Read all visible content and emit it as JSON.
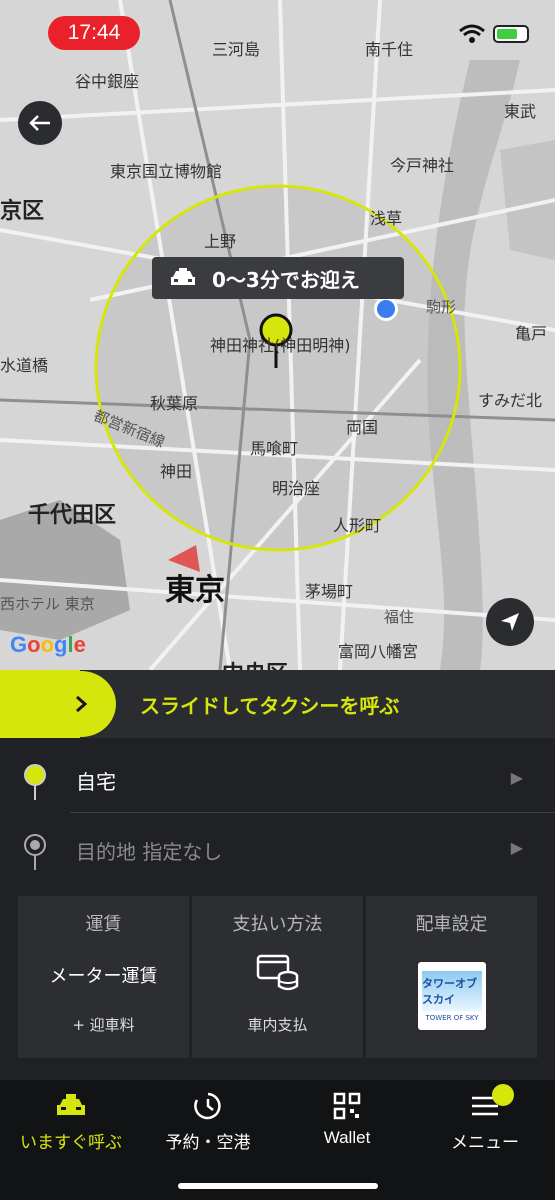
{
  "status_bar": {
    "time": "17:44"
  },
  "map": {
    "eta_text": "0～3分でお迎え",
    "labels": {
      "yanaka": "谷中銀座",
      "mikawashima": "三河島",
      "minamisenju": "南千住",
      "tokyo_museum": "東京国立博物館",
      "imado": "今戸神社",
      "bunkyo": "京区",
      "ueno": "上野",
      "asakusa": "浅草",
      "kameido": "亀戸",
      "mizudobashi": "水道橋",
      "kanda_myojin": "神田神社(神田明神)",
      "akihabara": "秋葉原",
      "sumida": "すみだ北",
      "ryogoku": "両国",
      "shinjuku_line": "都営新宿線",
      "bakurocho": "馬喰町",
      "kanda": "神田",
      "meijiza": "明治座",
      "chiyoda": "千代田区",
      "ningyocho": "人形町",
      "tokyo": "東京",
      "kayabacho": "茅場町",
      "hotel": "西ホテル 東京",
      "tomioka": "富岡八幡宮",
      "chuo": "中央区",
      "fukagawa": "福住",
      "higashi": "東武",
      "koma": "駒形"
    },
    "google": "Google"
  },
  "slide": {
    "text": "スライドしてタクシーを呼ぶ"
  },
  "places": [
    {
      "label": "自宅"
    },
    {
      "label": "目的地 指定なし"
    }
  ],
  "cards": [
    {
      "title": "運賃",
      "main": "メーター運賃",
      "sub": "+ 迎車料"
    },
    {
      "title": "支払い方法",
      "sub": "車内支払"
    },
    {
      "title": "配車設定",
      "logo_top": "タワーオブスカイ",
      "logo_bottom": "TOWER OF SKY"
    }
  ],
  "tabs": [
    {
      "label": "いますぐ呼ぶ",
      "icon": "taxi-icon"
    },
    {
      "label": "予約・空港",
      "icon": "clock-icon"
    },
    {
      "label": "Wallet",
      "icon": "qr-icon"
    },
    {
      "label": "メニュー",
      "icon": "menu-icon"
    }
  ],
  "colors": {
    "accent": "#d6e60c",
    "background": "#1f2124",
    "card": "#2c2e32",
    "status_red": "#e8212a"
  }
}
